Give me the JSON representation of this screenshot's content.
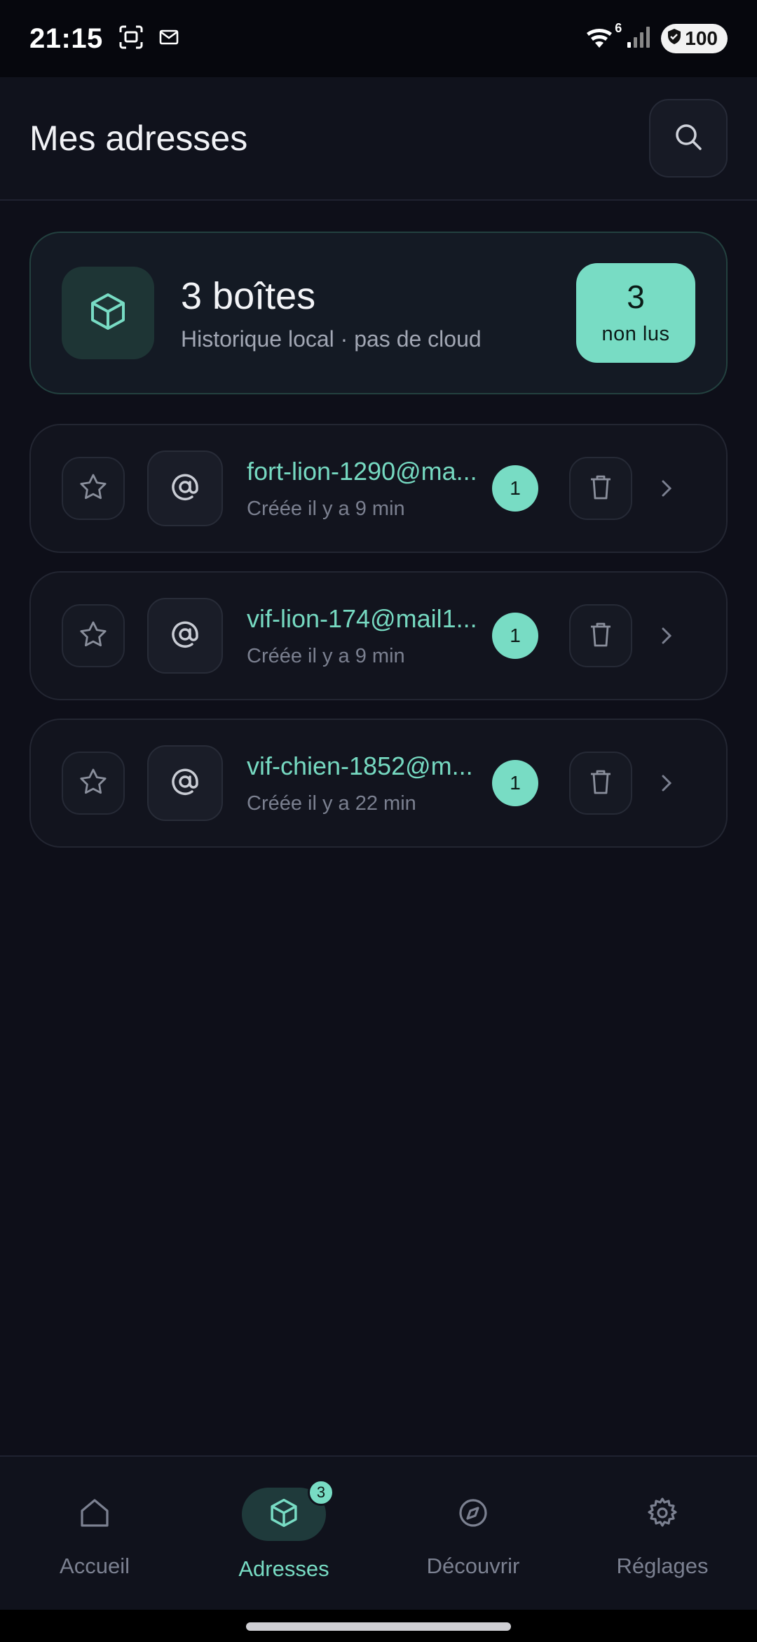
{
  "status_bar": {
    "time": "21:15",
    "left_icons": [
      "screenshot-icon",
      "mail-icon"
    ],
    "right_icons": [
      "wifi-icon",
      "signal-icon"
    ],
    "wifi_label": "6",
    "battery": "100"
  },
  "header": {
    "title": "Mes adresses",
    "search_icon": "search-icon"
  },
  "summary": {
    "title": "3 boîtes",
    "subtitle": "Historique local · pas de cloud",
    "unread_count": "3",
    "unread_label": "non lus",
    "icon": "cube-icon"
  },
  "addresses": [
    {
      "email": "fort-lion-1290@ma...",
      "created": "Créée il y a 9 min",
      "count": "1"
    },
    {
      "email": "vif-lion-174@mail1...",
      "created": "Créée il y a 9 min",
      "count": "1"
    },
    {
      "email": "vif-chien-1852@m...",
      "created": "Créée il y a 22 min",
      "count": "1"
    }
  ],
  "nav": {
    "items": [
      {
        "label": "Accueil",
        "icon": "home-icon"
      },
      {
        "label": "Adresses",
        "icon": "cube-icon",
        "badge": "3",
        "active": true
      },
      {
        "label": "Découvrir",
        "icon": "compass-icon"
      },
      {
        "label": "Réglages",
        "icon": "gear-icon"
      }
    ]
  },
  "colors": {
    "background": "#0e0f19",
    "accent": "#78dcc4",
    "card": "#12141e",
    "muted_text": "#7b8090"
  }
}
